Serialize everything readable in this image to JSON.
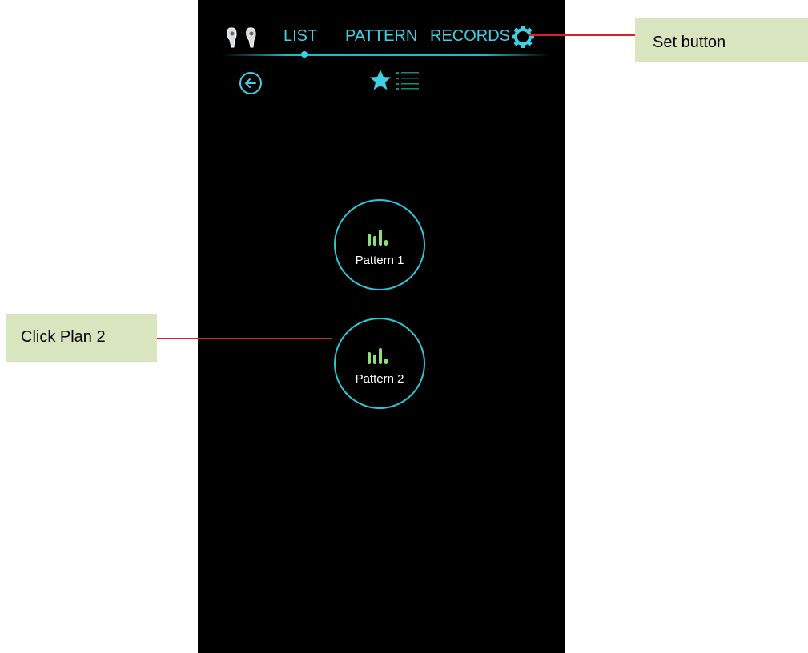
{
  "app": {
    "tabs": [
      {
        "label": "LIST",
        "active": true
      },
      {
        "label": "PATTERN",
        "active": false
      },
      {
        "label": "RECORDS",
        "active": false
      }
    ],
    "icons": {
      "bluetooth": "earbuds-icon",
      "settings": "gear-icon",
      "back": "back-arrow-icon",
      "favorites": "star-icon",
      "list": "list-icon",
      "pattern": "waveform-icon"
    },
    "patterns": [
      {
        "label": "Pattern 1"
      },
      {
        "label": "Pattern 2"
      }
    ]
  },
  "annotations": {
    "set_button": "Set button",
    "click_plan_2": "Click Plan 2"
  },
  "colors": {
    "background": "#000000",
    "accent": "#3fd0e4",
    "circle_border": "#27c9d9",
    "wave_green": "#8fe07a",
    "callout_bg": "#d8e5bf",
    "callout_line": "#d9232a"
  }
}
